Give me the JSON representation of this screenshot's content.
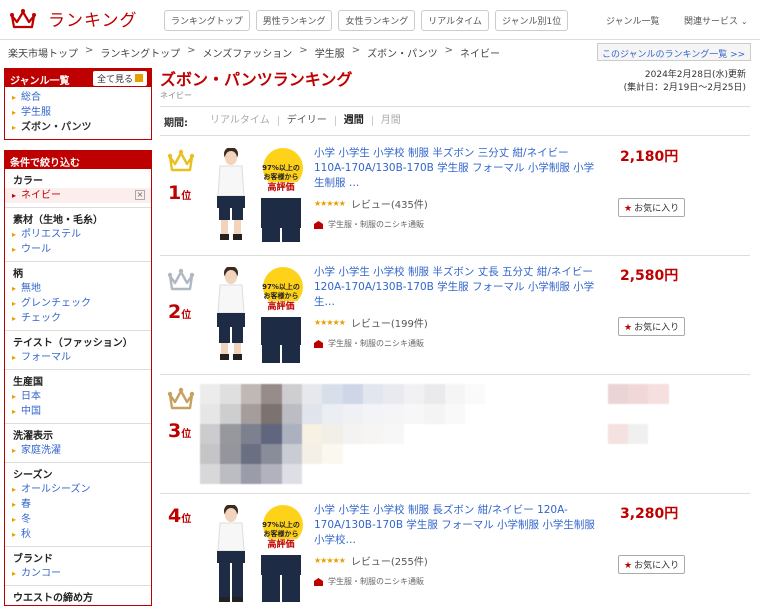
{
  "header": {
    "logo_title": "ランキング",
    "nav_tabs": [
      "ランキングトップ",
      "男性ランキング",
      "女性ランキング",
      "リアルタイム",
      "ジャンル別1位"
    ],
    "genre_list_link": "ジャンル一覧",
    "related_services": "関連サービス"
  },
  "breadcrumb": [
    "楽天市場トップ",
    "ランキングトップ",
    "メンズファッション",
    "学生服",
    "ズボン・パンツ",
    "ネイビー"
  ],
  "genre_ranking_list_button": "このジャンルのランキング一覧 >>",
  "sidebar": {
    "genre_title": "ジャンル一覧",
    "see_all": "全て見る",
    "genres": [
      "総合",
      "学生服",
      "ズボン・パンツ"
    ],
    "filter_title": "条件で絞り込む",
    "sections": [
      {
        "title": "カラー",
        "items": [
          "ネイビー"
        ]
      },
      {
        "title": "素材（生地・毛糸）",
        "items": [
          "ポリエステル",
          "ウール"
        ]
      },
      {
        "title": "柄",
        "items": [
          "無地",
          "グレンチェック",
          "チェック"
        ]
      },
      {
        "title": "テイスト（ファッション）",
        "items": [
          "フォーマル"
        ]
      },
      {
        "title": "生産国",
        "items": [
          "日本",
          "中国"
        ]
      },
      {
        "title": "洗濯表示",
        "items": [
          "家庭洗濯"
        ]
      },
      {
        "title": "シーズン",
        "items": [
          "オールシーズン",
          "春",
          "冬",
          "秋"
        ]
      },
      {
        "title": "ブランド",
        "items": [
          "カンコー"
        ]
      },
      {
        "title": "ウエストの締め方",
        "items": []
      }
    ]
  },
  "main": {
    "title": "ズボン・パンツランキング",
    "subtitle": "ネイビー",
    "updated": "2024年2月28日(水)更新",
    "period_range": "(集計日：2月19日～2月25日)",
    "period_label": "期間:",
    "periods": [
      {
        "label": "リアルタイム",
        "state": "disabled"
      },
      {
        "label": "デイリー",
        "state": "link"
      },
      {
        "label": "週間",
        "state": "current"
      },
      {
        "label": "月間",
        "state": "disabled"
      }
    ]
  },
  "thumb_text": {
    "line1": "97%以上の",
    "line2": "お客様から",
    "line3": "高評価"
  },
  "items": [
    {
      "rank": "1",
      "rank_suffix": "位",
      "crown": "gold",
      "title": "小学 小学生 小学校 制服 半ズボン 三分丈 紺/ネイビー 110A-170A/130B-170B 学生服 フォーマル 小学制服 小学生制服 …",
      "price": "2,180円",
      "review": "レビュー(435件)",
      "shop": "学生服・制服のニシキ通販",
      "fav": "お気に入り"
    },
    {
      "rank": "2",
      "rank_suffix": "位",
      "crown": "silver",
      "title": "小学 小学生 小学校 制服 半ズボン 丈長 五分丈 紺/ネイビー 120A-170A/130B-170B 学生服 フォーマル 小学制服 小学生…",
      "price": "2,580円",
      "review": "レビュー(199件)",
      "shop": "学生服・制服のニシキ通販",
      "fav": "お気に入り"
    },
    {
      "rank": "3",
      "rank_suffix": "位",
      "crown": "bronze"
    },
    {
      "rank": "4",
      "rank_suffix": "位",
      "title": "小学 小学生 小学校 制服 長ズボン 紺/ネイビー 120A-170A/130B-170B 学生服 フォーマル 小学制服 小学生制服 小学校…",
      "price": "3,280円",
      "review": "レビュー(255件)",
      "shop": "学生服・制服のニシキ通販",
      "fav": "お気に入り"
    }
  ],
  "colors": {
    "brand": "#bf0000",
    "link": "#3366cc",
    "gold": "#e8c020",
    "silver": "#b0b8c4",
    "bronze": "#c8a060"
  }
}
